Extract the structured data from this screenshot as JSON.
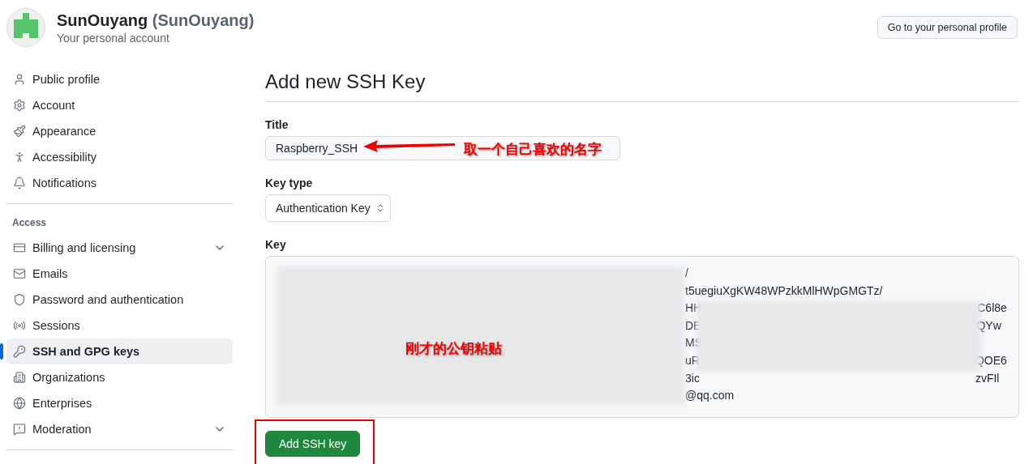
{
  "header": {
    "name": "SunOuyang",
    "login": "(SunOuyang)",
    "subtitle": "Your personal account",
    "profile_button": "Go to your personal profile"
  },
  "sidebar": {
    "groups": [
      {
        "items": [
          {
            "label": "Public profile",
            "kind": "link",
            "selected": false
          },
          {
            "label": "Account",
            "kind": "link",
            "selected": false
          },
          {
            "label": "Appearance",
            "kind": "link",
            "selected": false
          },
          {
            "label": "Accessibility",
            "kind": "link",
            "selected": false
          },
          {
            "label": "Notifications",
            "kind": "link",
            "selected": false
          }
        ]
      },
      {
        "heading": "Access",
        "items": [
          {
            "label": "Billing and licensing",
            "kind": "menu",
            "selected": false
          },
          {
            "label": "Emails",
            "kind": "link",
            "selected": false
          },
          {
            "label": "Password and authentication",
            "kind": "link",
            "selected": false
          },
          {
            "label": "Sessions",
            "kind": "link",
            "selected": false
          },
          {
            "label": "SSH and GPG keys",
            "kind": "link",
            "selected": true
          },
          {
            "label": "Organizations",
            "kind": "link",
            "selected": false
          },
          {
            "label": "Enterprises",
            "kind": "link",
            "selected": false
          },
          {
            "label": "Moderation",
            "kind": "menu",
            "selected": false
          }
        ]
      }
    ]
  },
  "form": {
    "heading": "Add new SSH Key",
    "title_label": "Title",
    "title_value": "Raspberry_SSH",
    "key_type_label": "Key type",
    "key_type_value": "Authentication Key",
    "key_label": "Key",
    "key_lines": [
      {
        "middle": "/"
      },
      {
        "middle": "t5uegiuXgKW48WPzkkMlHWpGMGTz/"
      },
      {
        "middle": "HH",
        "end": "C6l8e"
      },
      {
        "middle": "DE",
        "end": "QYw"
      },
      {
        "middle": "MS"
      },
      {
        "middle": "uR",
        "end": "QOE6"
      },
      {
        "middle": "3ic",
        "end": "zvFIl"
      },
      {
        "middle": "@qq.com"
      }
    ],
    "submit": "Add SSH key"
  },
  "annotations": [
    {
      "kind": "arrow-note",
      "text": "取一个自己喜欢的名字"
    },
    {
      "kind": "note",
      "text": "刚才的公钥粘贴"
    },
    {
      "kind": "highlight-box"
    }
  ]
}
